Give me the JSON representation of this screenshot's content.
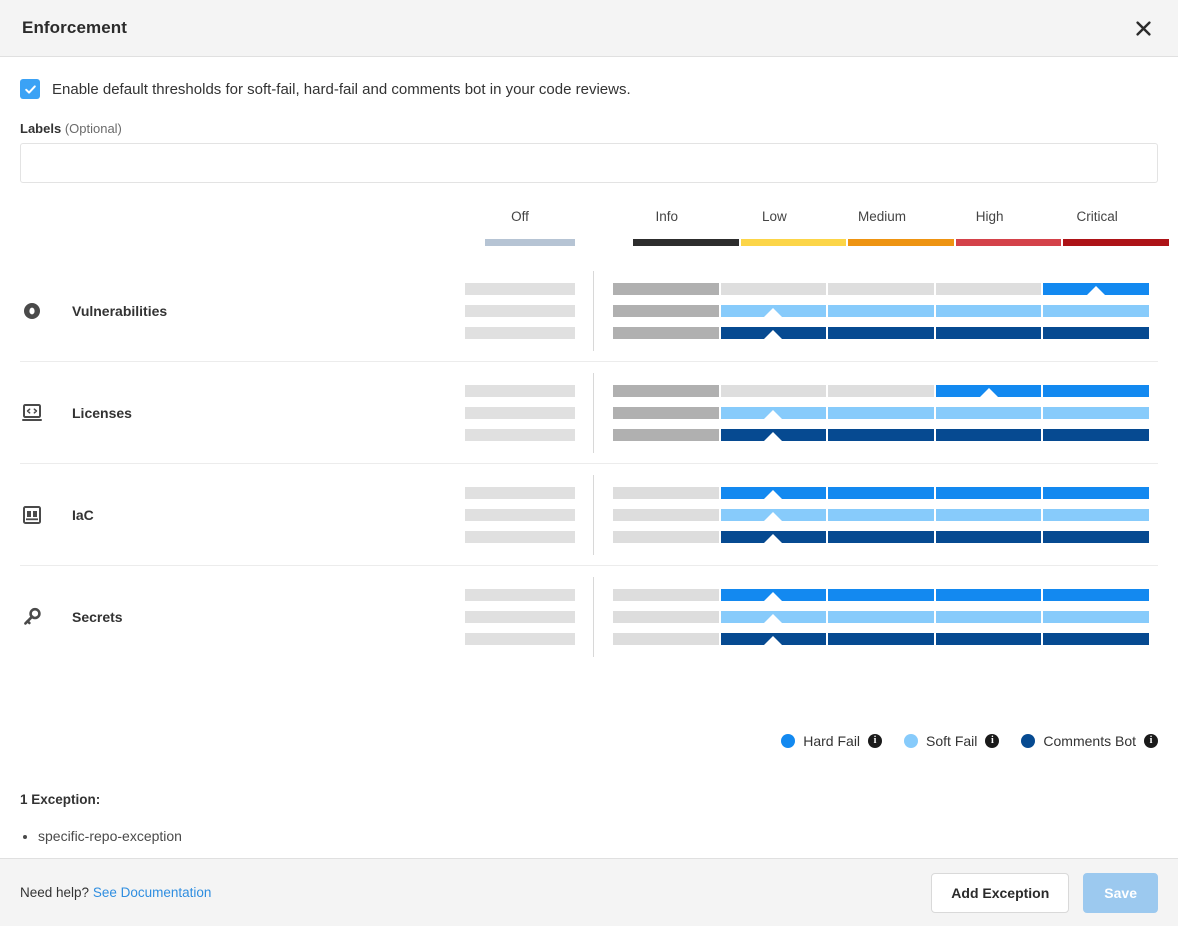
{
  "header": {
    "title": "Enforcement",
    "close_icon": "close-icon"
  },
  "body": {
    "enable_defaults": {
      "checked": true,
      "label": "Enable default thresholds for soft-fail, hard-fail and comments bot in your code reviews."
    },
    "labels_field": {
      "label": "Labels",
      "optional_suffix": "(Optional)",
      "value": "",
      "placeholder": ""
    }
  },
  "matrix": {
    "off_column": {
      "label": "Off",
      "color": "#b6c4d4"
    },
    "severity_columns": [
      {
        "label": "Info",
        "color": "#2d2d2d"
      },
      {
        "label": "Low",
        "color": "#fcd548"
      },
      {
        "label": "Medium",
        "color": "#ee9412"
      },
      {
        "label": "High",
        "color": "#d4424a"
      },
      {
        "label": "Critical",
        "color": "#ad1317"
      }
    ],
    "track_types": [
      {
        "key": "hard_fail",
        "label": "Hard Fail",
        "color": "#1389f0",
        "info_icon": "info-icon"
      },
      {
        "key": "soft_fail",
        "label": "Soft Fail",
        "color": "#87cbfb",
        "info_icon": "info-icon"
      },
      {
        "key": "comments_bot",
        "label": "Comments Bot",
        "color": "#064a91",
        "info_icon": "info-icon"
      }
    ],
    "inactive_colors": {
      "off_bar": "#e0e0e0",
      "info_active_gray": "#b0b0b0",
      "info_inactive_gray": "#dddddd",
      "segment_inactive": "#dedede"
    },
    "rows": [
      {
        "name": "Vulnerabilities",
        "icon": "vulnerability-icon",
        "tracks": [
          {
            "key": "hard_fail",
            "info_state": "active-gray",
            "threshold_index": 4
          },
          {
            "key": "soft_fail",
            "info_state": "active-gray",
            "threshold_index": 1
          },
          {
            "key": "comments_bot",
            "info_state": "active-gray",
            "threshold_index": 1
          }
        ]
      },
      {
        "name": "Licenses",
        "icon": "license-code-screen-icon",
        "tracks": [
          {
            "key": "hard_fail",
            "info_state": "active-gray",
            "threshold_index": 3
          },
          {
            "key": "soft_fail",
            "info_state": "active-gray",
            "threshold_index": 1
          },
          {
            "key": "comments_bot",
            "info_state": "active-gray",
            "threshold_index": 1
          }
        ]
      },
      {
        "name": "IaC",
        "icon": "iac-infrastructure-icon",
        "tracks": [
          {
            "key": "hard_fail",
            "info_state": "inactive-gray",
            "threshold_index": 1
          },
          {
            "key": "soft_fail",
            "info_state": "inactive-gray",
            "threshold_index": 1
          },
          {
            "key": "comments_bot",
            "info_state": "inactive-gray",
            "threshold_index": 1
          }
        ]
      },
      {
        "name": "Secrets",
        "icon": "key-icon",
        "tracks": [
          {
            "key": "hard_fail",
            "info_state": "inactive-gray",
            "threshold_index": 1
          },
          {
            "key": "soft_fail",
            "info_state": "inactive-gray",
            "threshold_index": 1
          },
          {
            "key": "comments_bot",
            "info_state": "inactive-gray",
            "threshold_index": 1
          }
        ]
      }
    ]
  },
  "exceptions": {
    "title": "1 Exception:",
    "items": [
      "specific-repo-exception"
    ]
  },
  "footer": {
    "need_help_text": "Need help?",
    "documentation_link": "See Documentation",
    "add_exception_label": "Add Exception",
    "save_label": "Save",
    "save_disabled": true
  }
}
